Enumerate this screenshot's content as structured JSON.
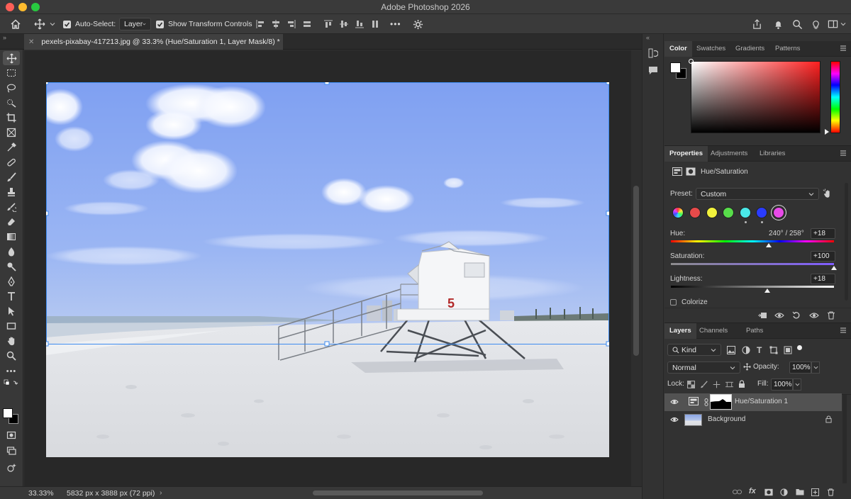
{
  "app": {
    "title": "Adobe Photoshop 2026"
  },
  "options_bar": {
    "auto_select_label": "Auto-Select:",
    "auto_select_value": "Layer",
    "show_transform_label": "Show Transform Controls",
    "more_label": "•••"
  },
  "document": {
    "tab_title": "pexels-pixabay-417213.jpg @ 33.3% (Hue/Saturation 1, Layer Mask/8) *",
    "zoom": "33.33%",
    "dimensions": "5832 px x 3888 px (72 ppi)",
    "lifeguard_number": "5"
  },
  "color_panel": {
    "tabs": [
      "Color",
      "Swatches",
      "Gradients",
      "Patterns"
    ],
    "active_tab": "Color"
  },
  "properties_panel": {
    "tabs": [
      "Properties",
      "Adjustments",
      "Libraries"
    ],
    "title": "Hue/Saturation",
    "preset_label": "Preset:",
    "preset_value": "Custom",
    "hue_label": "Hue:",
    "hue_range": "240° / 258°",
    "hue_value": "+18",
    "saturation_label": "Saturation:",
    "saturation_value": "+100",
    "lightness_label": "Lightness:",
    "lightness_value": "+18",
    "colorize_label": "Colorize",
    "hue_slider_fraction": 0.6,
    "saturation_slider_fraction": 1.0,
    "lightness_slider_fraction": 0.59,
    "swatch_colors": [
      "#e84a4a",
      "#f2f23c",
      "#58dd4a",
      "#4ae8e8",
      "#2a3cff",
      "#e84ae8"
    ],
    "selected_swatch_index": 5
  },
  "layers_panel": {
    "tabs": [
      "Layers",
      "Channels",
      "Paths"
    ],
    "filter_label": "Kind",
    "blend_mode": "Normal",
    "opacity_label": "Opacity:",
    "opacity_value": "100%",
    "lock_label": "Lock:",
    "fill_label": "Fill:",
    "fill_value": "100%",
    "layers": [
      {
        "name": "Hue/Saturation 1",
        "visible": true,
        "selected": true
      },
      {
        "name": "Background",
        "visible": true,
        "selected": false,
        "locked": true
      }
    ]
  },
  "colors": {
    "accent": "#1473e6",
    "panel_bg": "#323232",
    "canvas_bg": "#282828"
  }
}
